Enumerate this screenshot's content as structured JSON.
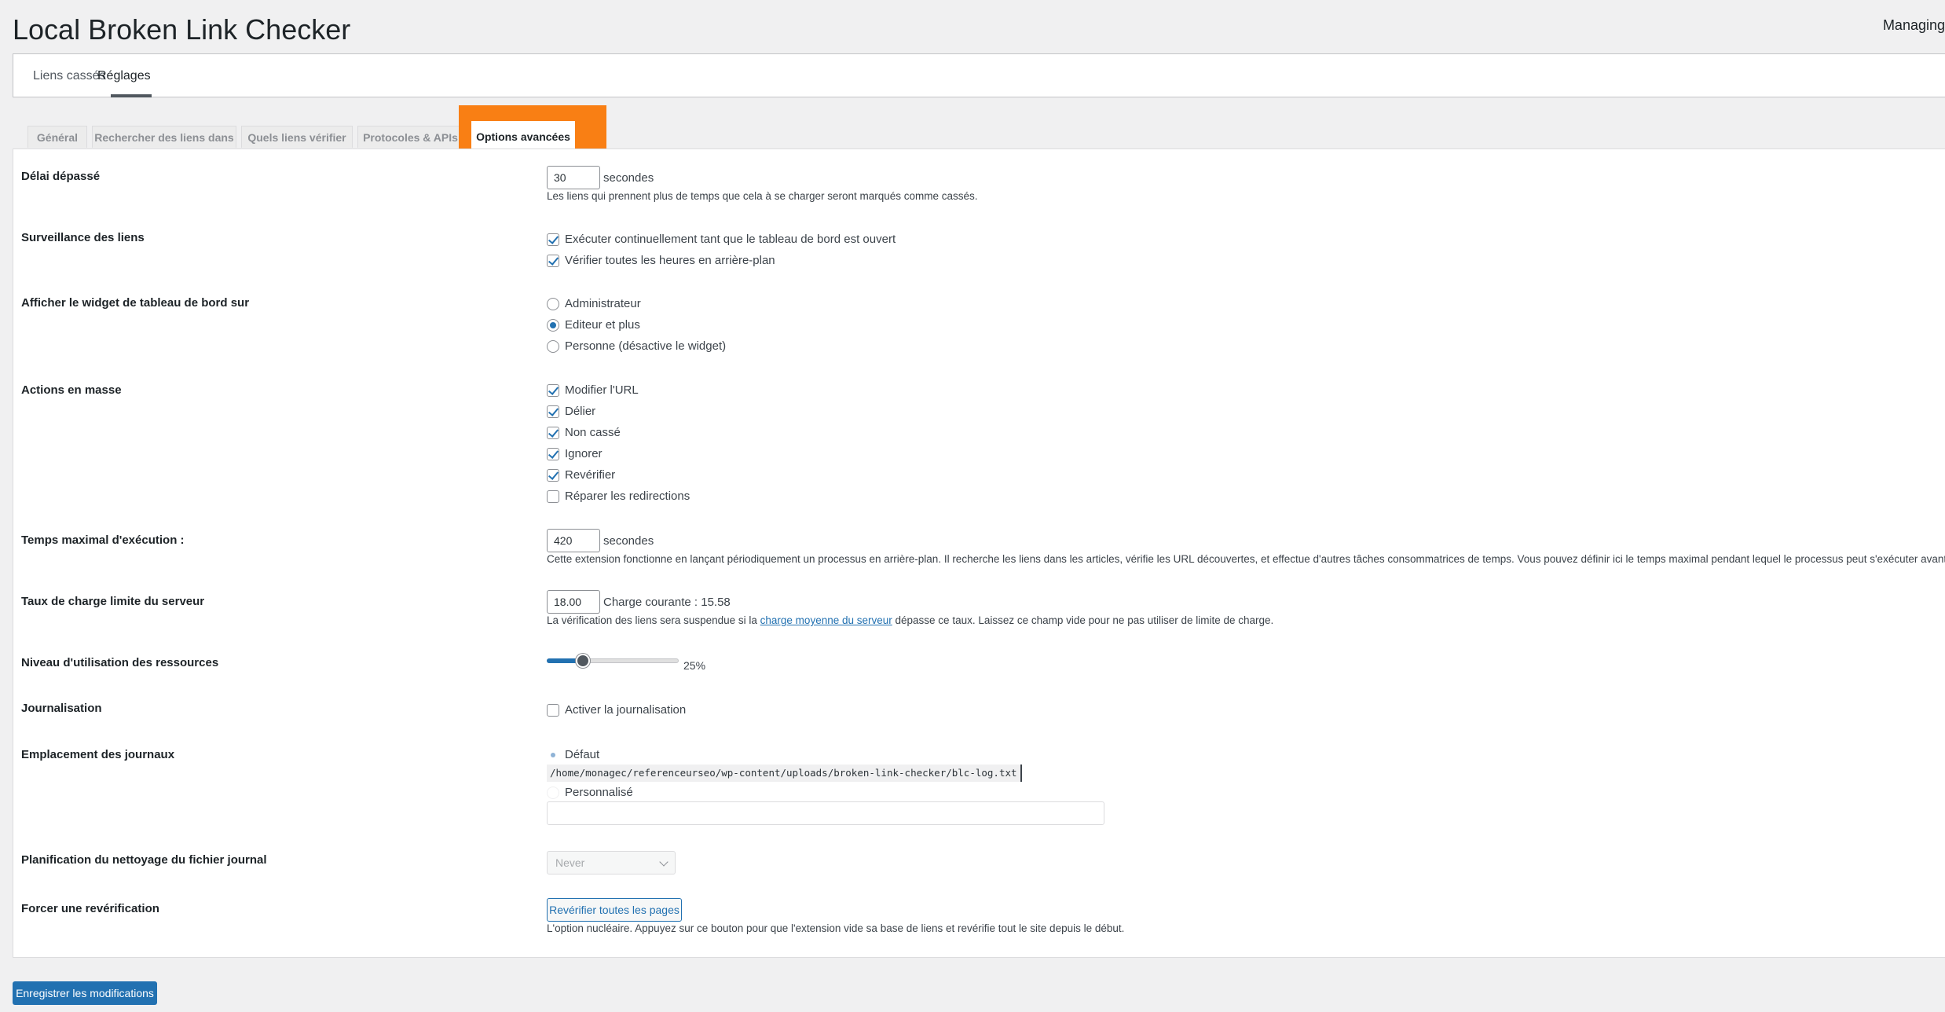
{
  "header": {
    "title": "Local Broken Link Checker",
    "right_text": "Managing"
  },
  "subnav": {
    "items": [
      "Liens cassés",
      "Réglages"
    ],
    "active": "Réglages"
  },
  "tabs": [
    "Général",
    "Rechercher des liens dans",
    "Quels liens vérifier",
    "Protocoles & APIs",
    "Options avancées"
  ],
  "active_tab": "Options avancées",
  "settings": {
    "timeout": {
      "label": "Délai dépassé",
      "value": "30",
      "unit": "secondes",
      "desc": "Les liens qui prennent plus de temps que cela à se charger seront marqués comme cassés."
    },
    "monitoring": {
      "label": "Surveillance des liens",
      "options": [
        {
          "text": "Exécuter continuellement tant que le tableau de bord est ouvert",
          "checked": true
        },
        {
          "text": "Vérifier toutes les heures en arrière-plan",
          "checked": true
        }
      ]
    },
    "widget": {
      "label": "Afficher le widget de tableau de bord sur",
      "options": [
        {
          "text": "Administrateur",
          "checked": false
        },
        {
          "text": "Editeur et plus",
          "checked": true
        },
        {
          "text": "Personne (désactive le widget)",
          "checked": false
        }
      ]
    },
    "bulk": {
      "label": "Actions en masse",
      "options": [
        {
          "text": "Modifier l'URL",
          "checked": true
        },
        {
          "text": "Délier",
          "checked": true
        },
        {
          "text": "Non cassé",
          "checked": true
        },
        {
          "text": "Ignorer",
          "checked": true
        },
        {
          "text": "Revérifier",
          "checked": true
        },
        {
          "text": "Réparer les redirections",
          "checked": false
        }
      ]
    },
    "max_exec": {
      "label": "Temps maximal d'exécution :",
      "value": "420",
      "unit": "secondes",
      "desc": "Cette extension fonctionne en lançant périodiquement un processus en arrière-plan. Il recherche les liens dans les articles, vérifie les URL découvertes, et effectue d'autres tâches consommatrices de temps. Vous pouvez définir ici le temps maximal pendant lequel le processus peut s'exécuter avant de s'arrêter."
    },
    "load": {
      "label": "Taux de charge limite du serveur",
      "value": "18.00",
      "current": "Charge courante : 15.58",
      "desc_before": "La vérification des liens sera suspendue si la ",
      "desc_link": "charge moyenne du serveur",
      "desc_after": " dépasse ce taux. Laissez ce champ vide pour ne pas utiliser de limite de charge."
    },
    "resources": {
      "label": "Niveau d'utilisation des ressources",
      "value_text": "25%",
      "fraction": 0.25
    },
    "logging": {
      "label": "Journalisation",
      "option": "Activer la journalisation",
      "checked": false
    },
    "log_location": {
      "label": "Emplacement des journaux",
      "default_label": "Défaut",
      "path": "/home/monagec/referenceurseo/wp-content/uploads/broken-link-checker/blc-log.txt",
      "custom_label": "Personnalisé",
      "custom_value": ""
    },
    "cleanup": {
      "label": "Planification du nettoyage du fichier journal",
      "selected": "Never"
    },
    "force": {
      "label": "Forcer une revérification",
      "button": "Revérifier toutes les pages",
      "desc": "L'option nucléaire. Appuyez sur ce bouton pour que l'extension vide sa base de liens et revérifie tout le site depuis le début."
    }
  },
  "save_button": "Enregistrer les modifications",
  "colors": {
    "accent": "#2271b1",
    "highlight": "#f97f14"
  }
}
